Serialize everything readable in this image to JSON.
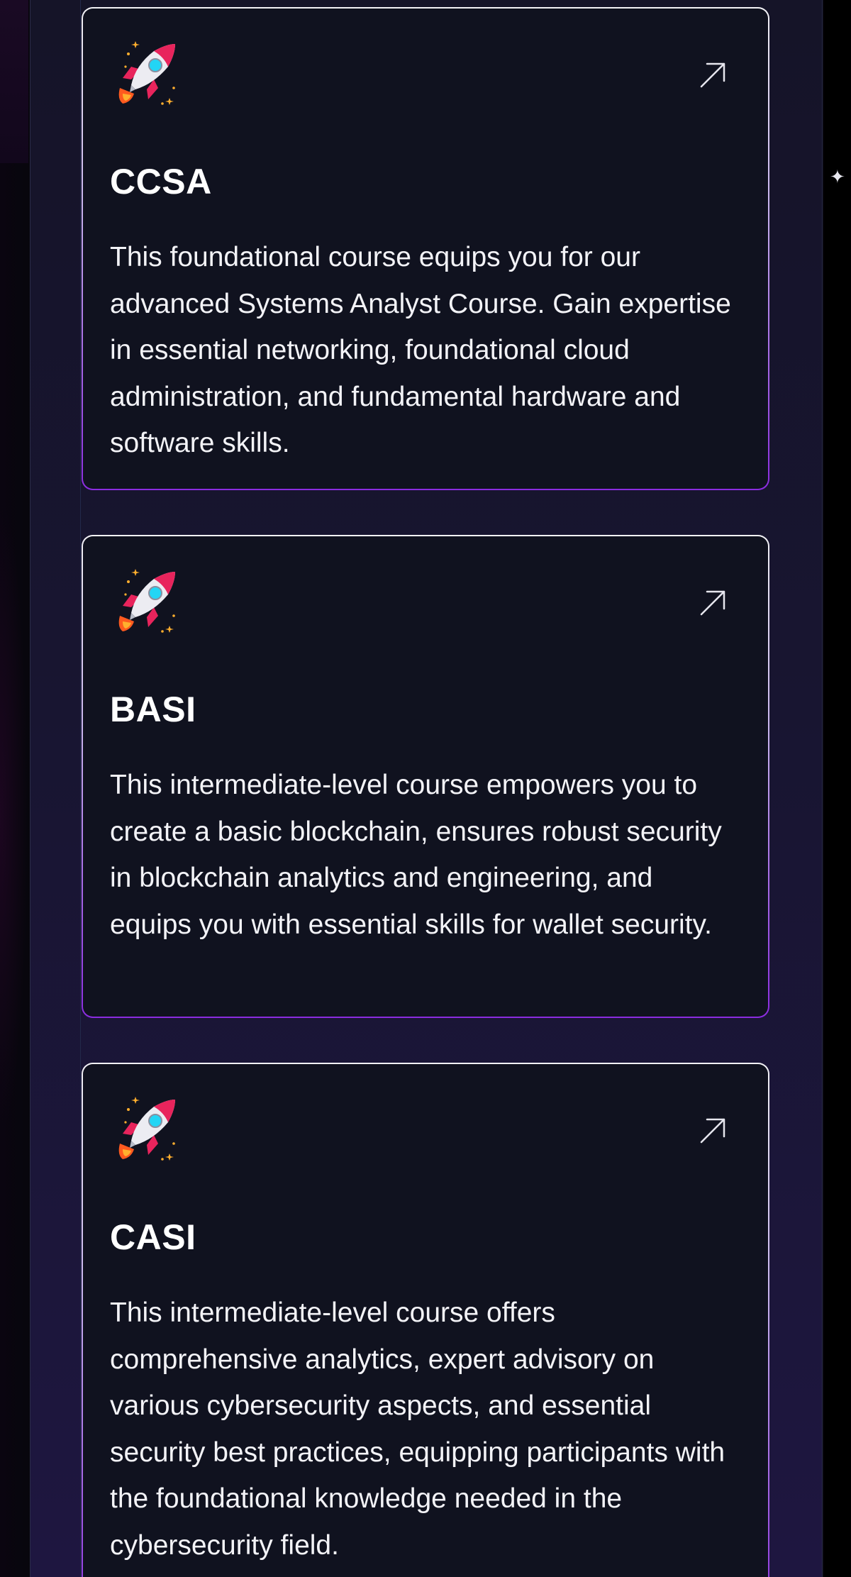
{
  "courses": [
    {
      "title": "CCSA",
      "description": "This foundational course equips you for our advanced Systems Analyst Course. Gain expertise in essential networking, foundational cloud administration, and fundamental hardware and software skills.",
      "icon": "rocket-icon",
      "link_icon": "arrow-up-right-icon"
    },
    {
      "title": "BASI",
      "description": "This intermediate-level course empowers you to create a basic blockchain, ensures robust security in blockchain analytics and engineering, and equips you with essential skills for wallet security.",
      "icon": "rocket-icon",
      "link_icon": "arrow-up-right-icon"
    },
    {
      "title": "CASI",
      "description": "This intermediate-level course offers comprehensive analytics, expert advisory on various cybersecurity aspects, and essential security best practices, equipping participants with the foundational knowledge needed in the cybersecurity field.",
      "icon": "rocket-icon",
      "link_icon": "arrow-up-right-icon"
    }
  ],
  "colors": {
    "card_background": "#10121f",
    "card_border_top": "#f2f2f6",
    "card_border_bottom": "#8b2ce0",
    "panel_background": "#181531",
    "text": "#ffffff"
  }
}
